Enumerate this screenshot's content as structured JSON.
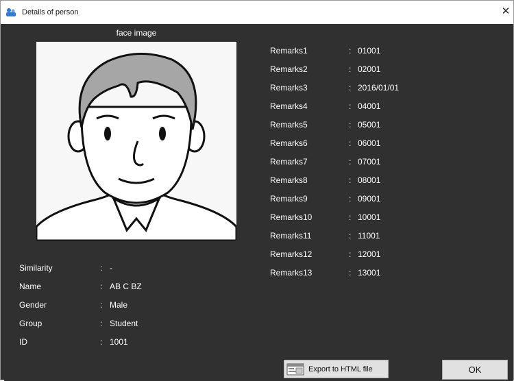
{
  "window": {
    "title": "Details of person",
    "close_glyph": "✕",
    "app_icon": "app-icon"
  },
  "face": {
    "caption": "face image"
  },
  "person": {
    "fields": [
      {
        "label": "Similarity",
        "sep": ":",
        "value": "-"
      },
      {
        "label": "Name",
        "sep": ":",
        "value": "AB C BZ"
      },
      {
        "label": "Gender",
        "sep": ":",
        "value": "Male"
      },
      {
        "label": "Group",
        "sep": ":",
        "value": "Student"
      },
      {
        "label": "ID",
        "sep": ":",
        "value": "1001"
      }
    ]
  },
  "remarks": [
    {
      "label": "Remarks1",
      "sep": ":",
      "value": "01001"
    },
    {
      "label": "Remarks2",
      "sep": ":",
      "value": "02001"
    },
    {
      "label": "Remarks3",
      "sep": ":",
      "value": "2016/01/01"
    },
    {
      "label": "Remarks4",
      "sep": ":",
      "value": "04001"
    },
    {
      "label": "Remarks5",
      "sep": ":",
      "value": "05001"
    },
    {
      "label": "Remarks6",
      "sep": ":",
      "value": "06001"
    },
    {
      "label": "Remarks7",
      "sep": ":",
      "value": "07001"
    },
    {
      "label": "Remarks8",
      "sep": ":",
      "value": "08001"
    },
    {
      "label": "Remarks9",
      "sep": ":",
      "value": "09001"
    },
    {
      "label": "Remarks10",
      "sep": ":",
      "value": "10001"
    },
    {
      "label": "Remarks11",
      "sep": ":",
      "value": "11001"
    },
    {
      "label": "Remarks12",
      "sep": ":",
      "value": "12001"
    },
    {
      "label": "Remarks13",
      "sep": ":",
      "value": "13001"
    }
  ],
  "buttons": {
    "export_label": "Export to HTML file",
    "export_icon": "html-export-icon",
    "ok_label": "OK"
  }
}
